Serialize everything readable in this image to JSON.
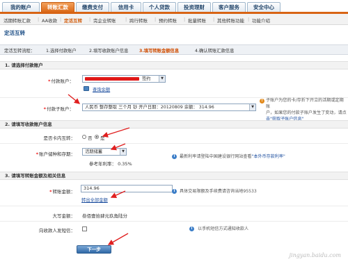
{
  "nav": {
    "tabs": [
      {
        "label": "我的账户"
      },
      {
        "label": "转账汇款"
      },
      {
        "label": "缴费支付"
      },
      {
        "label": "信用卡"
      },
      {
        "label": "个人贷款"
      },
      {
        "label": "投资理财"
      },
      {
        "label": "客户服务"
      },
      {
        "label": "安全中心"
      }
    ]
  },
  "subnav": {
    "items": [
      {
        "label": "活期转账汇款"
      },
      {
        "label": "AA收款"
      },
      {
        "label": "定活互转"
      },
      {
        "label": "完企业转账"
      },
      {
        "label": "跨行转账"
      },
      {
        "label": "预约转账"
      },
      {
        "label": "批量转账"
      },
      {
        "label": "其他转账功能"
      },
      {
        "label": "功能介绍"
      }
    ]
  },
  "page_title": "定活互转",
  "steps": {
    "prefix": "定活互转流程：",
    "step1": "1.选择付款账户",
    "step2": "2.填写收款账户信息",
    "step3": "3.填写转账金额信息",
    "step4": "4.确认转账汇款信息"
  },
  "section1": {
    "title": "1. 请选择付款账户",
    "payer_label": "付款账户：",
    "payer_suffix": "签约",
    "query_balance": "查询余额",
    "sub_account_label": "付款子账户：",
    "sub_account_value": "人民币  整存整取  三个月      钞  开户日期：20120809      余额：  314.96",
    "sub_account_note_1": "子账户为您的卡/存折下开立的活期或定期账",
    "sub_account_note_2": "户，如果您的付款子账户发生了变动，请点",
    "sub_account_note_3": "击\"获取子账户信息\""
  },
  "section2": {
    "title": "2. 请填写收款账户信息",
    "same_card_label": "是否卡内互转：",
    "radio_no": "否",
    "radio_yes": "是",
    "type_label": "账户储种和存期：",
    "type_value": "活期储蓄",
    "rate_text": "参考年利率： 0.35%",
    "rate_note_prefix": "最新利率请登陆中国建设银行网站查看",
    "rate_note_link": "\"本外币存款利率\""
  },
  "section3": {
    "title": "3. 请填写转账金额及相关信息",
    "amount_label": "转账金额：",
    "amount_value": "314.96",
    "transfer_all": "转出全部金额",
    "uppercase_label": "大写金额：",
    "uppercase_value": "叁佰壹拾肆元玖角陆分",
    "amount_note": "具体交易限额及手续费请咨询当地95533",
    "notify_label": "向收款人发短信：",
    "notify_note": "以手机短信方式通知收款人"
  },
  "next_button": "下一步",
  "watermark": "jingyan.baidu.com",
  "colors": {
    "accent": "#d86414",
    "primary_blue": "#1b4d85",
    "arrow_red": "#e02020"
  }
}
